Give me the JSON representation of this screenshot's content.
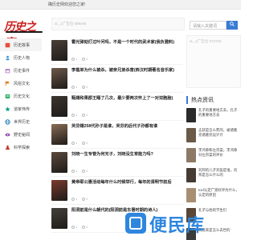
{
  "topbar": {
    "text": "确历史网欢迎您之家!"
  },
  "logo": {
    "text": "历史之家"
  },
  "search": {
    "placeholder": "请输入关键词"
  },
  "ads": {
    "top": "xL_1广告位 689x90",
    "side": "xL_1广告位 073720"
  },
  "sidebar": {
    "items": [
      {
        "label": "历史故事",
        "icon": "book-icon",
        "color": "#e74c3c"
      },
      {
        "label": "历史人物",
        "icon": "person-icon",
        "color": "#3498db"
      },
      {
        "label": "历史事件",
        "icon": "calendar-icon",
        "color": "#9b59b6"
      },
      {
        "label": "风俗文化",
        "icon": "flag-icon",
        "color": "#e67e22"
      },
      {
        "label": "历史文化",
        "icon": "scroll-icon",
        "color": "#27ae60"
      },
      {
        "label": "道家伟传",
        "icon": "star-icon",
        "color": "#16a085"
      },
      {
        "label": "世界历史",
        "icon": "globe-icon",
        "color": "#2980b9"
      },
      {
        "label": "野史秘闻",
        "icon": "eye-icon",
        "color": "#8e44ad"
      },
      {
        "label": "科学探索",
        "icon": "flask-icon",
        "color": "#c0392b"
      }
    ]
  },
  "feed": [
    {
      "title": "霍光弹劾打过叶问吗，不是一个时代的武术家(我负雅料)",
      "time": "1",
      "views": "2"
    },
    {
      "title": "李槛单为什么被杀，被亲兄弟杀害(西汉时期著名音乐家)",
      "time": "1",
      "views": "2"
    },
    {
      "title": "甄嬛和果郡王睡了几次，最少要两次怀上了一对双胞胎)",
      "time": "1",
      "views": "2"
    },
    {
      "title": "芙芬嬛258代孙子是谁，芙芬的后代子孙都有谁",
      "time": "1",
      "views": "2"
    },
    {
      "title": "刘晓一生专管为何无子，刘晓没生育能力吗?",
      "time": "1",
      "views": "2"
    },
    {
      "title": "黄帝耶公惠活动每年什么时候举行，每年的清明节前后",
      "time": "1",
      "views": "2"
    },
    {
      "title": "阳洞前是什么朝代的(阳洞前是东晋时期的诗人)",
      "time": "1",
      "views": "2"
    }
  ],
  "hot": {
    "title": "热点资讯",
    "items": [
      {
        "text": "孔子的重要地方去，孔子的重要地方去"
      },
      {
        "text": "孟获是怎么死的，被诸葛亮诸葛亮设计计"
      },
      {
        "text": "李鸿章和左宗棠，李鸿章对左宗棠的评价"
      },
      {
        "text": "刘邦的儿子刘盈是谁，刘邦是怎么什么的"
      },
      {
        "text": "tocl认定广受好评为什么，认定的原因"
      },
      {
        "text": "孔子与他的学生们"
      },
      {
        "text": "周恩来是怎么去世的"
      }
    ]
  },
  "watermark": {
    "text": "便民库"
  }
}
